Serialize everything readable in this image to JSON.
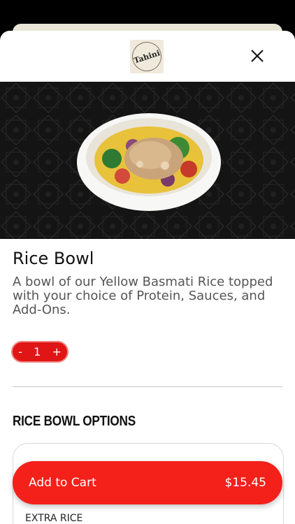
{
  "header": {
    "logo_text": "Tahini",
    "close_icon": "close-icon"
  },
  "item": {
    "name": "Rice Bowl",
    "description": "A bowl of our Yellow Basmati Rice topped with your choice of Protein, Sauces, and Add-Ons.",
    "image_icon": "rice-bowl-photo"
  },
  "quantity": {
    "minus": "-",
    "value": "1",
    "plus": "+"
  },
  "options": {
    "section_title": "RICE BOWL OPTIONS",
    "first_option_label": "EXTRA RICE"
  },
  "cart": {
    "label": "Add to Cart",
    "price": "$15.45"
  },
  "colors": {
    "accent": "#f4201a",
    "hero_bg": "#151515",
    "logo_bg": "#efeadb"
  }
}
